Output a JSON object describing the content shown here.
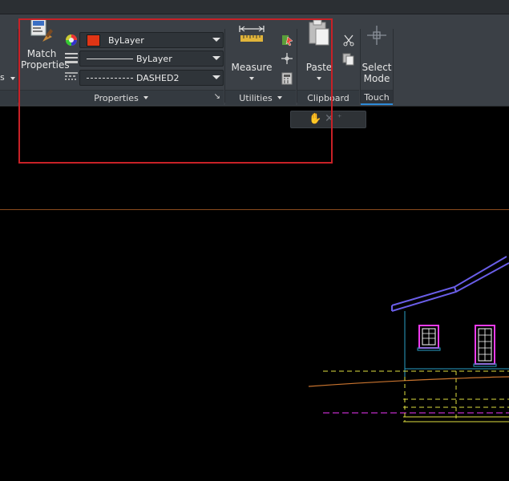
{
  "properties_panel": {
    "match_properties_label_line1": "Match",
    "match_properties_label_line2": "Properties",
    "color_value": "ByLayer",
    "linetype_value": "ByLayer",
    "linetype_pattern_value": "DASHED2",
    "footer_label": "Properties"
  },
  "utilities_panel": {
    "measure_label": "Measure",
    "footer_label": "Utilities"
  },
  "clipboard_panel": {
    "paste_label": "Paste",
    "footer_label": "Clipboard"
  },
  "touch_panel": {
    "select_mode_line1": "Select",
    "select_mode_line2": "Mode",
    "footer_label": "Touch"
  },
  "left_cutoff_label": "s",
  "colors": {
    "ribbon_bg": "#3b4046",
    "highlight_box": "#c82127",
    "color_swatch": "#e03515",
    "canvas_bg": "#000000"
  }
}
